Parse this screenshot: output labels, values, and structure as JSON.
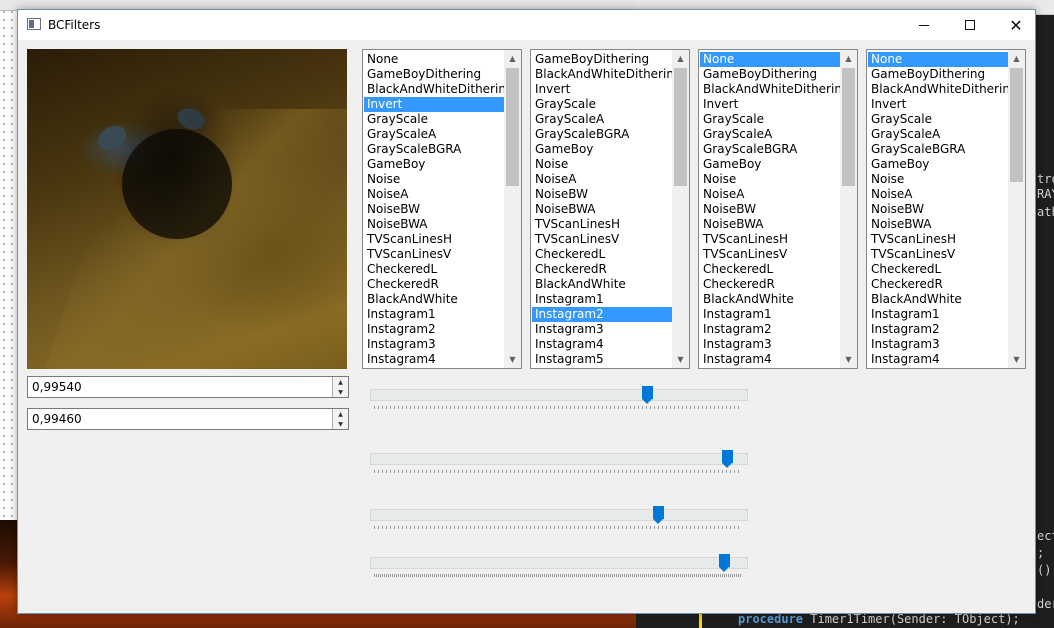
{
  "window": {
    "title": "BCFilters",
    "close_glyph": "✕"
  },
  "spin_edits": [
    {
      "value": "0,99540"
    },
    {
      "value": "0,99460"
    }
  ],
  "listboxes": [
    {
      "items": [
        "None",
        "GameBoyDithering",
        "BlackAndWhiteDithering",
        "Invert",
        "GrayScale",
        "GrayScaleA",
        "GrayScaleBGRA",
        "GameBoy",
        "Noise",
        "NoiseA",
        "NoiseBW",
        "NoiseBWA",
        "TVScanLinesH",
        "TVScanLinesV",
        "CheckeredL",
        "CheckeredR",
        "BlackAndWhite",
        "Instagram1",
        "Instagram2",
        "Instagram3",
        "Instagram4"
      ],
      "selected": "Invert"
    },
    {
      "items": [
        "GameBoyDithering",
        "BlackAndWhiteDithering",
        "Invert",
        "GrayScale",
        "GrayScaleA",
        "GrayScaleBGRA",
        "GameBoy",
        "Noise",
        "NoiseA",
        "NoiseBW",
        "NoiseBWA",
        "TVScanLinesH",
        "TVScanLinesV",
        "CheckeredL",
        "CheckeredR",
        "BlackAndWhite",
        "Instagram1",
        "Instagram2",
        "Instagram3",
        "Instagram4",
        "Instagram5"
      ],
      "selected": "Instagram2"
    },
    {
      "items": [
        "None",
        "GameBoyDithering",
        "BlackAndWhiteDithering",
        "Invert",
        "GrayScale",
        "GrayScaleA",
        "GrayScaleBGRA",
        "GameBoy",
        "Noise",
        "NoiseA",
        "NoiseBW",
        "NoiseBWA",
        "TVScanLinesH",
        "TVScanLinesV",
        "CheckeredL",
        "CheckeredR",
        "BlackAndWhite",
        "Instagram1",
        "Instagram2",
        "Instagram3",
        "Instagram4"
      ],
      "selected": "None"
    },
    {
      "items": [
        "None",
        "GameBoyDithering",
        "BlackAndWhiteDithering",
        "Invert",
        "GrayScale",
        "GrayScaleA",
        "GrayScaleBGRA",
        "GameBoy",
        "Noise",
        "NoiseA",
        "NoiseBW",
        "NoiseBWA",
        "TVScanLinesH",
        "TVScanLinesV",
        "CheckeredL",
        "CheckeredR",
        "BlackAndWhite",
        "Instagram1",
        "Instagram2",
        "Instagram3",
        "Instagram4"
      ],
      "selected": "None"
    }
  ],
  "trackbars": [
    {
      "level": 0.745
    },
    {
      "level": 0.965
    },
    {
      "level": 0.775
    },
    {
      "level": 0.955
    }
  ],
  "background": {
    "code_keyword": "procedure",
    "code_rest": " Timer1Timer(Sender: TObject);",
    "code_fragments": [
      "tro",
      "RAY",
      "ath",
      "ect",
      ";",
      "();",
      "der"
    ]
  },
  "colors": {
    "selection": "#3399ff",
    "trackbar_thumb": "#0078d7"
  }
}
